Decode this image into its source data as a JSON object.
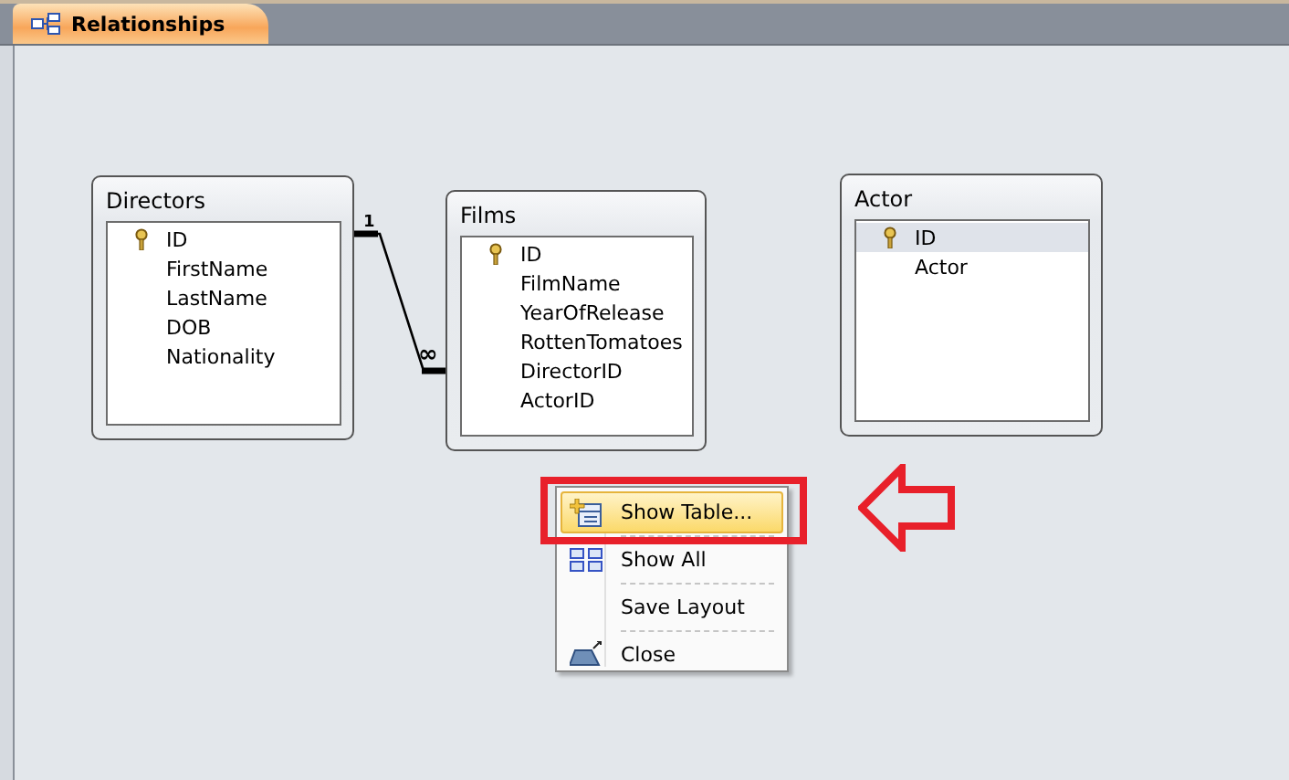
{
  "tabs": [
    {
      "label": "Relationships",
      "selected": true
    }
  ],
  "tables": [
    {
      "title": "Directors",
      "fields": [
        {
          "name": "ID",
          "primary_key": true,
          "selected": false
        },
        {
          "name": "FirstName",
          "primary_key": false,
          "selected": false
        },
        {
          "name": "LastName",
          "primary_key": false,
          "selected": false
        },
        {
          "name": "DOB",
          "primary_key": false,
          "selected": false
        },
        {
          "name": "Nationality",
          "primary_key": false,
          "selected": false
        }
      ]
    },
    {
      "title": "Films",
      "fields": [
        {
          "name": "ID",
          "primary_key": true,
          "selected": false
        },
        {
          "name": "FilmName",
          "primary_key": false,
          "selected": false
        },
        {
          "name": "YearOfRelease",
          "primary_key": false,
          "selected": false
        },
        {
          "name": "RottenTomatoes",
          "primary_key": false,
          "selected": false
        },
        {
          "name": "DirectorID",
          "primary_key": false,
          "selected": false
        },
        {
          "name": "ActorID",
          "primary_key": false,
          "selected": false
        }
      ]
    },
    {
      "title": "Actor",
      "fields": [
        {
          "name": "ID",
          "primary_key": true,
          "selected": true
        },
        {
          "name": "Actor",
          "primary_key": false,
          "selected": false
        }
      ]
    }
  ],
  "relationship": {
    "one_label": "1",
    "many_label": "∞"
  },
  "context_menu": [
    {
      "label": "Show Table...",
      "kind": "show-table",
      "selected": true
    },
    {
      "label": "Show All",
      "kind": "show-all",
      "selected": false
    },
    {
      "label": "Save Layout",
      "kind": "plain",
      "selected": false
    },
    {
      "label": "Close",
      "kind": "close",
      "selected": false
    }
  ]
}
